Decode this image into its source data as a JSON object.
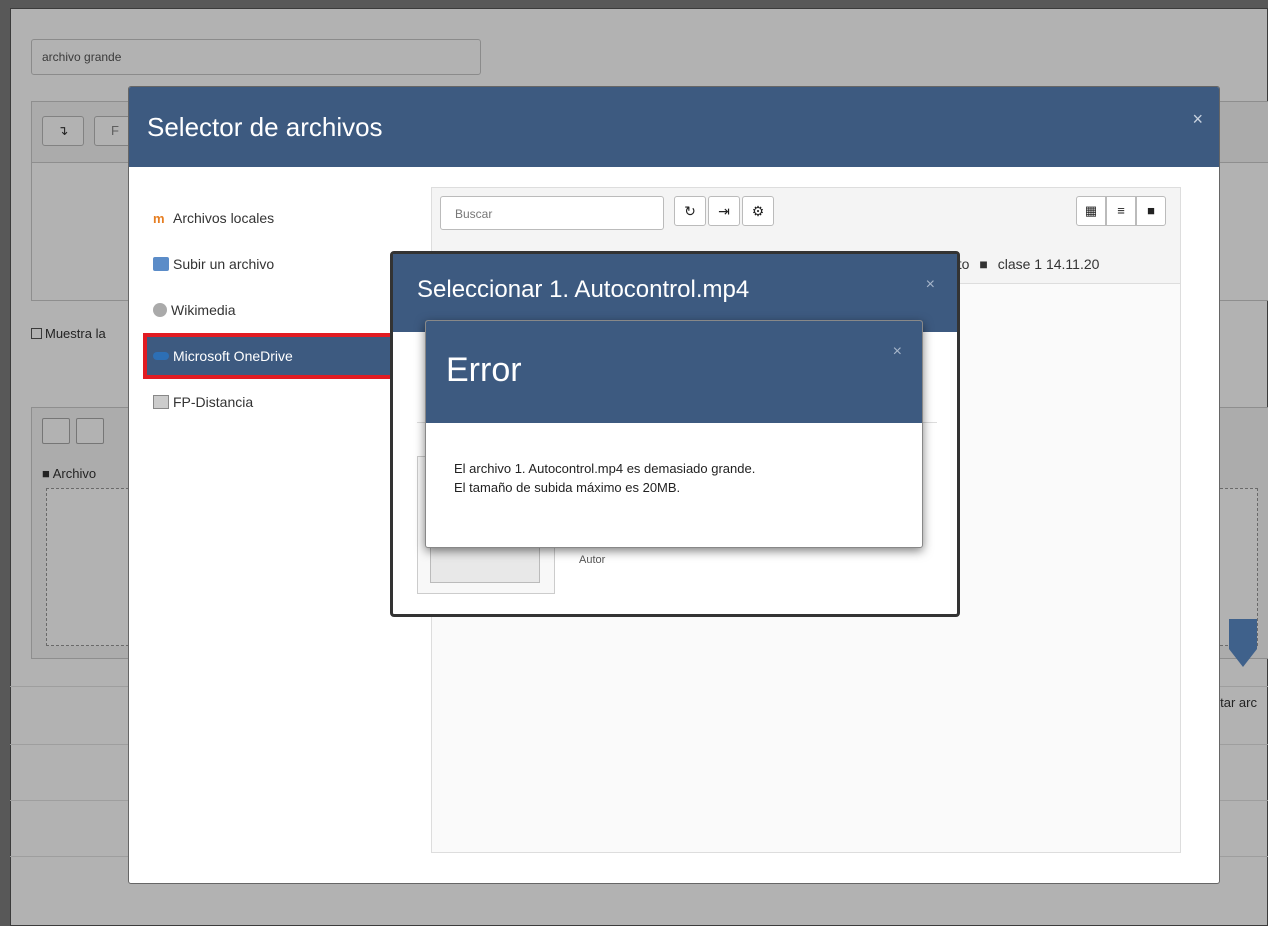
{
  "background": {
    "field_value": "archivo grande",
    "toolbar_partial": "F",
    "checkbox_partial": "Muestra la",
    "path_partial": "Archivo",
    "drop_partial": "ltar arc"
  },
  "picker": {
    "title": "Selector de archivos",
    "close": "×",
    "repositories": [
      {
        "label": "Archivos locales",
        "icon": "moodle-icon"
      },
      {
        "label": "Subir un archivo",
        "icon": "upload-icon"
      },
      {
        "label": "Wikimedia",
        "icon": "wikimedia-icon"
      },
      {
        "label": "Microsoft OneDrive",
        "icon": "onedrive-icon",
        "active": true
      },
      {
        "label": "FP-Distancia",
        "icon": "folder-icon"
      }
    ],
    "search_placeholder": "Buscar",
    "breadcrumb_partial": "nto",
    "breadcrumb_folder": "clase 1 14.11.20"
  },
  "select_dialog": {
    "title": "Seleccionar 1. Autocontrol.mp4",
    "close": "×",
    "author_label": "Autor"
  },
  "error_dialog": {
    "title": "Error",
    "close": "×",
    "line1": "El archivo 1. Autocontrol.mp4 es demasiado grande.",
    "line2": "El tamaño de subida máximo es 20MB."
  },
  "colors": {
    "header": "#3d5a80",
    "highlight": "#e11b22"
  }
}
